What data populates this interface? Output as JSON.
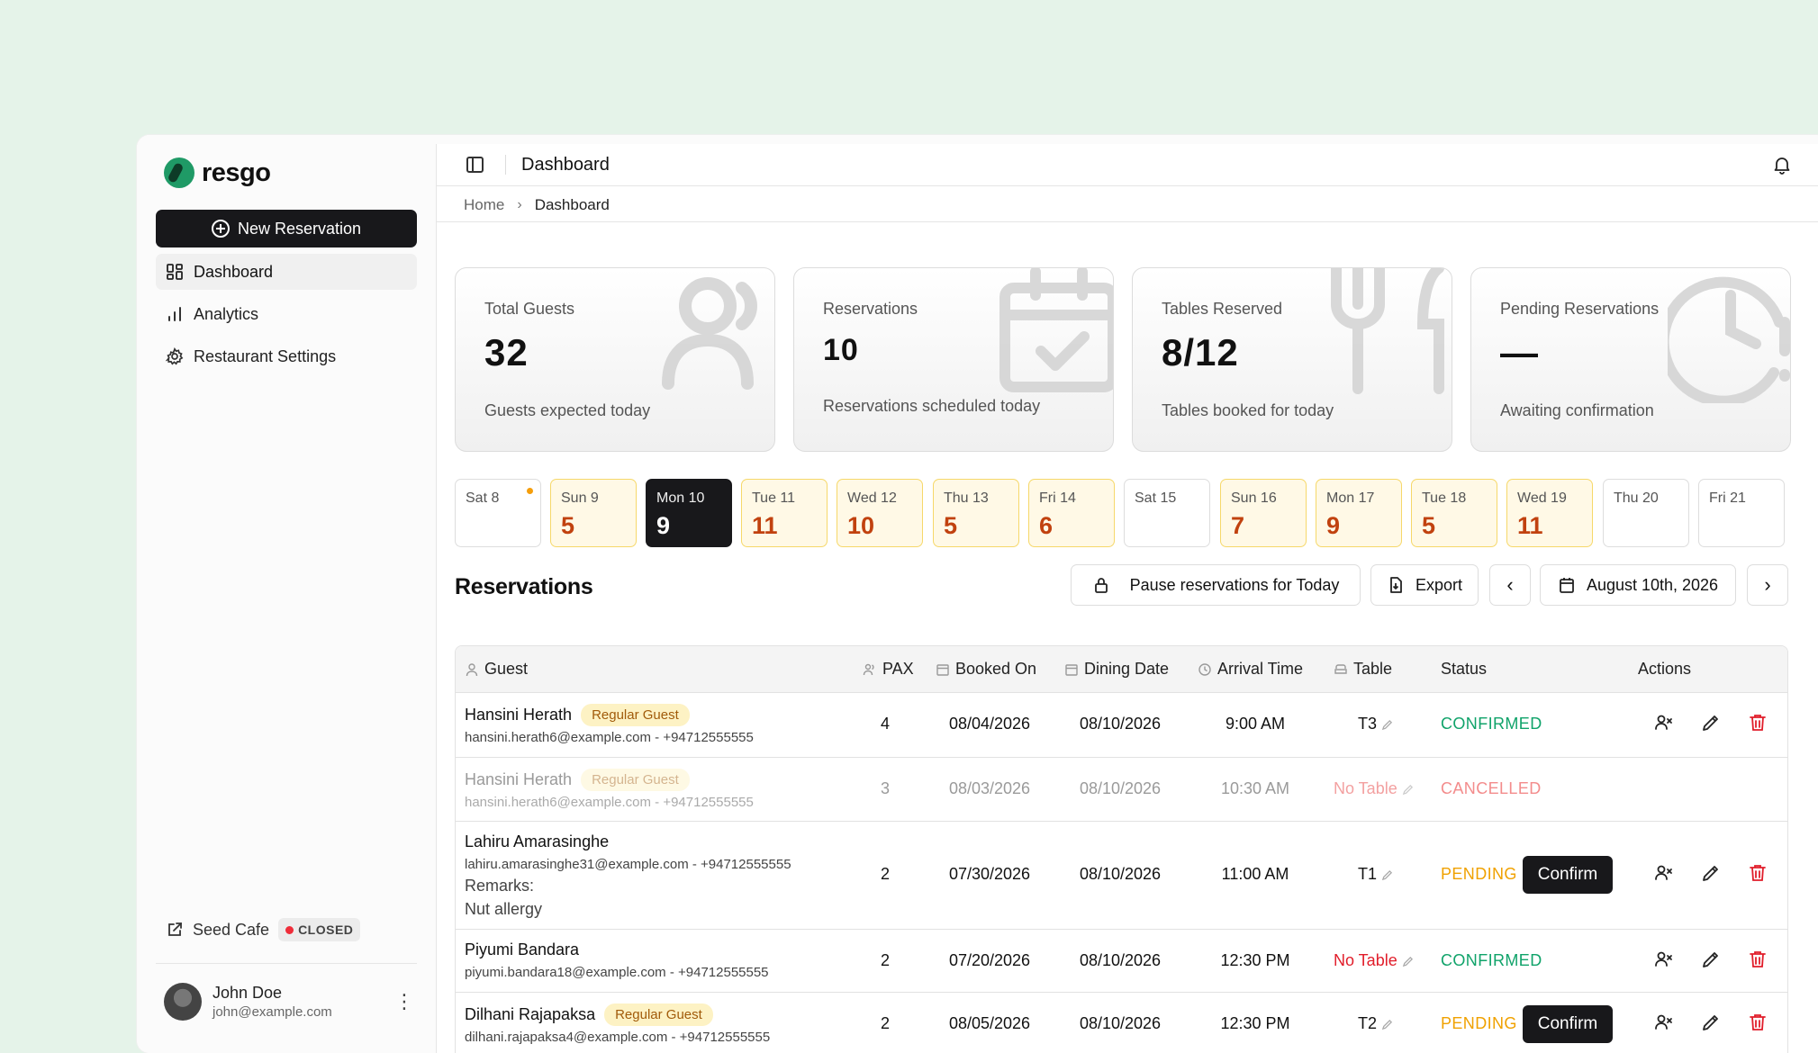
{
  "sidebar": {
    "brand": "resgo",
    "new_reservation": "New Reservation",
    "nav": [
      {
        "label": "Dashboard",
        "icon": "grid-icon",
        "active": true
      },
      {
        "label": "Analytics",
        "icon": "bar-chart-icon",
        "active": false
      },
      {
        "label": "Restaurant Settings",
        "icon": "gear-icon",
        "active": false
      }
    ],
    "cafe_name": "Seed Cafe",
    "cafe_status": "CLOSED",
    "user": {
      "name": "John Doe",
      "email": "john@example.com"
    }
  },
  "topbar": {
    "title": "Dashboard"
  },
  "breadcrumb": {
    "home": "Home",
    "current": "Dashboard"
  },
  "cards": [
    {
      "label": "Total Guests",
      "value": "32",
      "sub": "Guests expected today",
      "icon": "users-icon"
    },
    {
      "label": "Reservations",
      "value": "10",
      "sub": "Reservations scheduled today",
      "icon": "calendar-check-icon"
    },
    {
      "label": "Tables Reserved",
      "value": "8/12",
      "sub": "Tables booked for today",
      "icon": "utensils-icon"
    },
    {
      "label": "Pending Reservations",
      "value": "—",
      "sub": "Awaiting confirmation",
      "icon": "clock-alert-icon"
    }
  ],
  "days": [
    {
      "label": "Sat 8",
      "count": "",
      "dot": true
    },
    {
      "label": "Sun 9",
      "count": "5"
    },
    {
      "label": "Mon 10",
      "count": "9",
      "selected": true
    },
    {
      "label": "Tue 11",
      "count": "11"
    },
    {
      "label": "Wed 12",
      "count": "10"
    },
    {
      "label": "Thu 13",
      "count": "5"
    },
    {
      "label": "Fri 14",
      "count": "6"
    },
    {
      "label": "Sat 15",
      "count": ""
    },
    {
      "label": "Sun 16",
      "count": "7"
    },
    {
      "label": "Mon 17",
      "count": "9"
    },
    {
      "label": "Tue 18",
      "count": "5"
    },
    {
      "label": "Wed 19",
      "count": "11"
    },
    {
      "label": "Thu 20",
      "count": ""
    },
    {
      "label": "Fri 21",
      "count": ""
    }
  ],
  "reservations": {
    "title": "Reservations",
    "pause_label": "Pause reservations for Today",
    "export_label": "Export",
    "date_label": "August 10th, 2026"
  },
  "columns": [
    "Guest",
    "PAX",
    "Booked On",
    "Dining Date",
    "Arrival Time",
    "Table",
    "Status",
    "Actions"
  ],
  "rows": [
    {
      "name": "Hansini Herath",
      "badge": "Regular Guest",
      "contact": "hansini.herath6@example.com - +94712555555",
      "pax": "4",
      "booked": "08/04/2026",
      "dining": "08/10/2026",
      "arrival": "9:00 AM",
      "table": "T3",
      "status": "CONFIRMED"
    },
    {
      "name": "Hansini Herath",
      "badge": "Regular Guest",
      "contact": "hansini.herath6@example.com - +94712555555",
      "pax": "3",
      "booked": "08/03/2026",
      "dining": "08/10/2026",
      "arrival": "10:30 AM",
      "table": "No Table",
      "status": "CANCELLED"
    },
    {
      "name": "Lahiru Amarasinghe",
      "badge": "",
      "contact": "lahiru.amarasinghe31@example.com - +94712555555",
      "remarks_label": "Remarks:",
      "remarks": "Nut allergy",
      "pax": "2",
      "booked": "07/30/2026",
      "dining": "08/10/2026",
      "arrival": "11:00 AM",
      "table": "T1",
      "status": "PENDING",
      "confirm": "Confirm"
    },
    {
      "name": "Piyumi Bandara",
      "badge": "",
      "contact": "piyumi.bandara18@example.com - +94712555555",
      "pax": "2",
      "booked": "07/20/2026",
      "dining": "08/10/2026",
      "arrival": "12:30 PM",
      "table": "No Table",
      "status": "CONFIRMED"
    },
    {
      "name": "Dilhani Rajapaksa",
      "badge": "Regular Guest",
      "contact": "dilhani.rajapaksa4@example.com - +94712555555",
      "pax": "2",
      "booked": "08/05/2026",
      "dining": "08/10/2026",
      "arrival": "12:30 PM",
      "table": "T2",
      "status": "PENDING",
      "confirm": "Confirm"
    }
  ],
  "colors": {
    "accent": "#18181b",
    "confirmed": "#10a36a",
    "pending": "#f0a100",
    "cancelled": "#f38c8c",
    "no_table": "#e11d2a",
    "brand": "#1f9a66"
  }
}
